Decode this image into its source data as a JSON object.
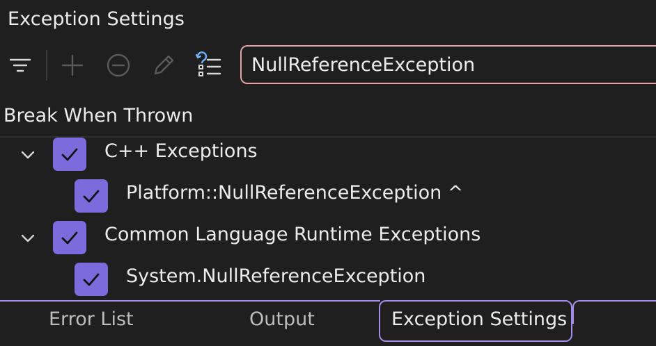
{
  "window": {
    "title": "Exception Settings"
  },
  "toolbar": {
    "buttons": [
      {
        "name": "filter",
        "icon": "filter-icon"
      },
      {
        "name": "add",
        "icon": "plus-icon"
      },
      {
        "name": "remove",
        "icon": "minus-circle-icon"
      },
      {
        "name": "edit",
        "icon": "pencil-icon"
      },
      {
        "name": "restore-defaults",
        "icon": "restore-list-icon"
      }
    ]
  },
  "search": {
    "value": "NullReferenceException",
    "placeholder": ""
  },
  "column": {
    "header": "Break When Thrown"
  },
  "tree": {
    "items": [
      {
        "label": "C++ Exceptions",
        "checked": true,
        "expanded": true,
        "level": 0
      },
      {
        "label": "Platform::NullReferenceException ^",
        "checked": true,
        "level": 1
      },
      {
        "label": "Common Language Runtime Exceptions",
        "checked": true,
        "expanded": true,
        "level": 0
      },
      {
        "label": "System.NullReferenceException",
        "checked": true,
        "level": 1
      }
    ]
  },
  "tabs": [
    {
      "label": "Error List",
      "active": false
    },
    {
      "label": "Output",
      "active": false
    },
    {
      "label": "Exception Settings",
      "active": true
    }
  ],
  "colors": {
    "accent": "#7b6bdc",
    "tab_border": "#a38de8",
    "search_border": "#e6a3a8",
    "background": "#1f1f1f"
  }
}
